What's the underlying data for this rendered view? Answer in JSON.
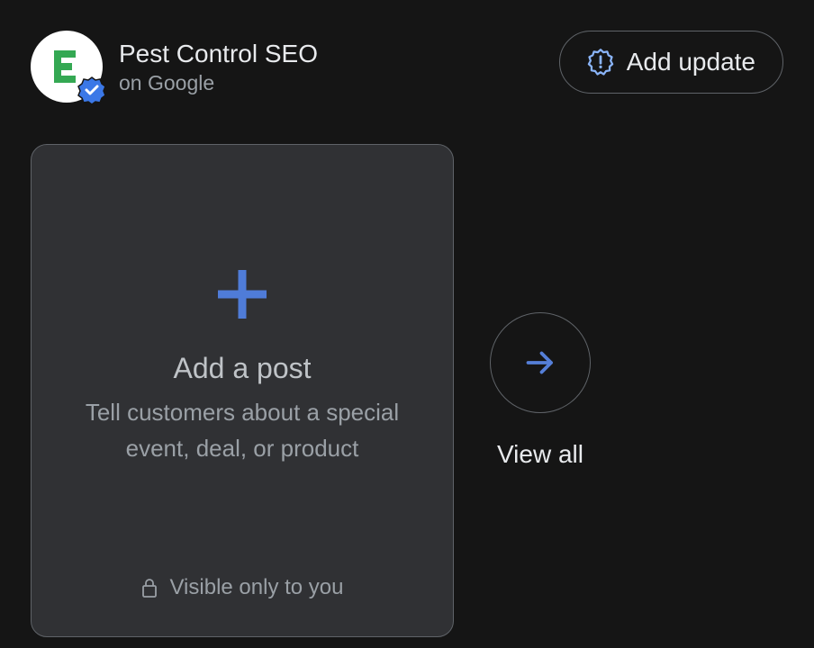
{
  "profile": {
    "name": "Pest Control SEO",
    "subtitle": "on Google"
  },
  "header": {
    "add_update_label": "Add update"
  },
  "post_card": {
    "title": "Add a post",
    "description": "Tell customers about a special event, deal, or product",
    "visibility": "Visible only to you"
  },
  "view_all": {
    "label": "View all"
  },
  "colors": {
    "accent": "#4f7cd8",
    "verified_badge": "#3b78e7"
  }
}
